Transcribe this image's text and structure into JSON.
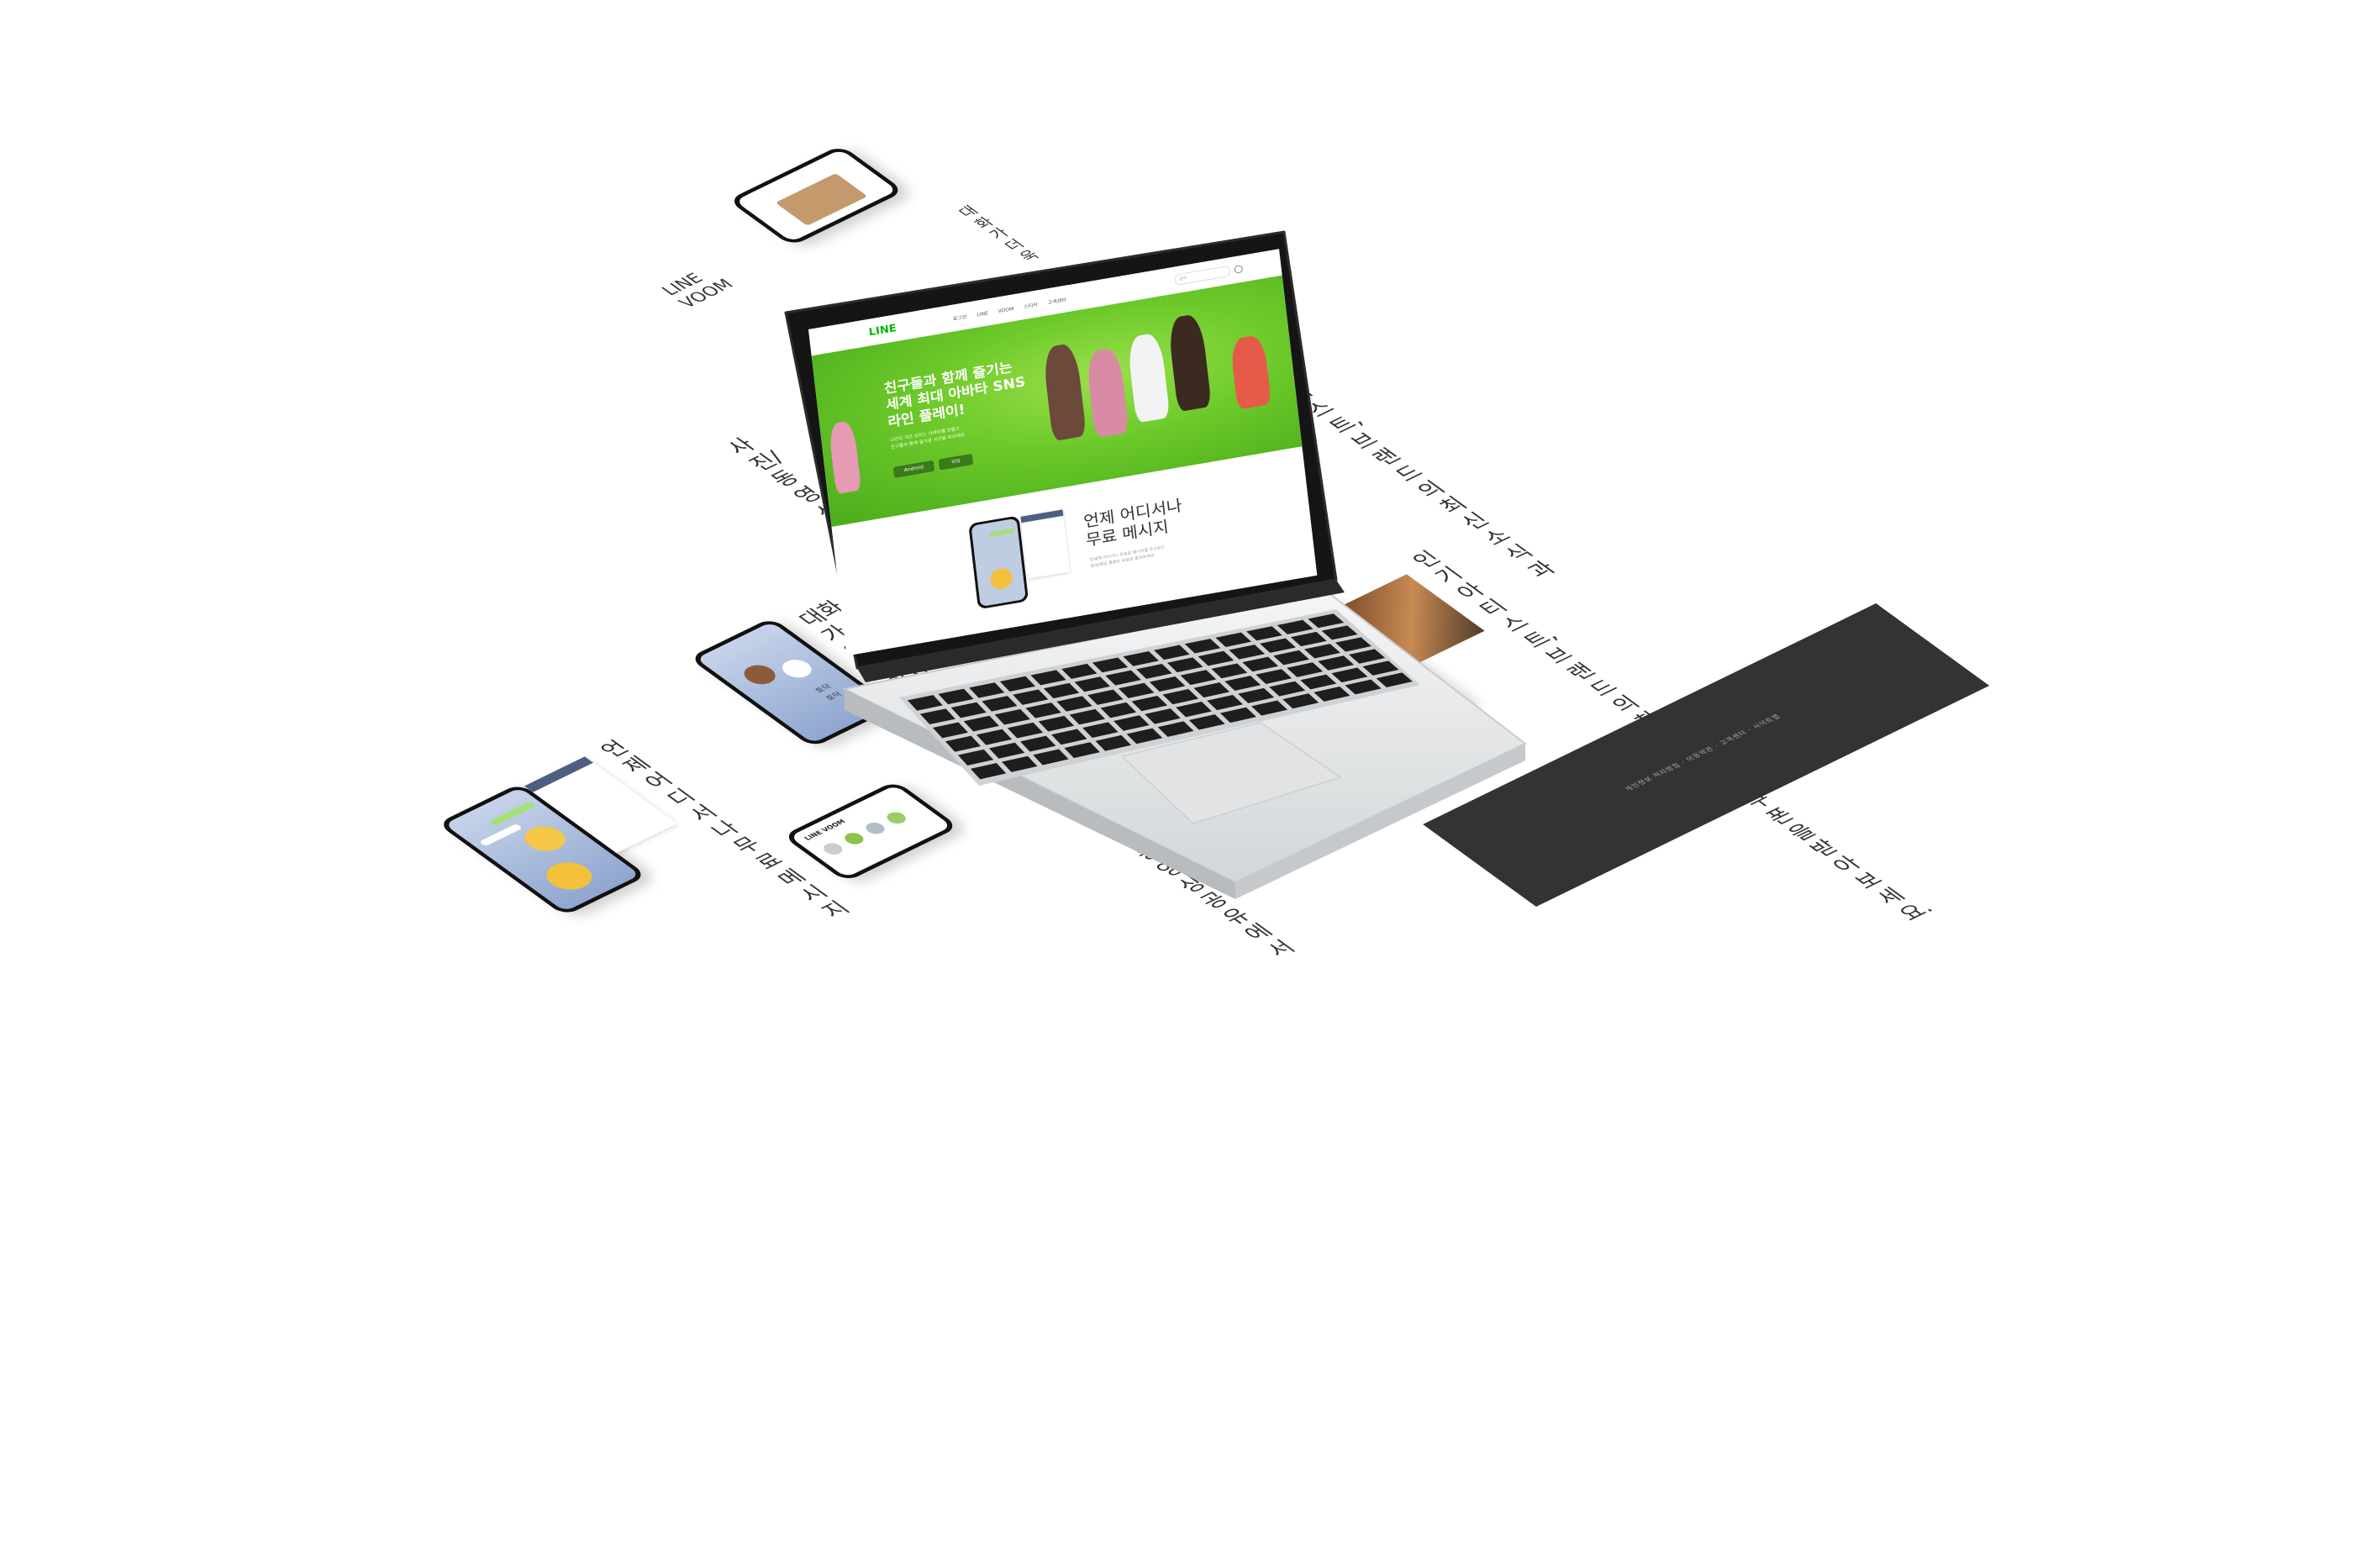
{
  "laptop": {
    "site": {
      "logo": "LINE",
      "menu": "로그인  LINE VOOM  스티커  고객센터",
      "search_placeholder": "검색",
      "hero_title": "친구들과 함께 즐기는\n세계 최대 아바타 SNS\n라인 플레이!",
      "hero_desc": "나만의 개성 넘치는 아바타를 만들고\n친구들과 함께 즐거운 시간을 보내세요.",
      "btn_android": "Android",
      "btn_ios": "iOS",
      "section_title": "언제 어디서나\n무료 메시지",
      "section_desc": "전세계 어디서나 무료로 메시지를 주고받고\n음성/영상 통화도 무료로 즐겨보세요."
    }
  },
  "floor": {
    "cards": [
      {
        "id": "message",
        "title": "언제 어디서나\n무료 메시지"
      },
      {
        "id": "voom-small",
        "label": "LINE VOOM"
      },
      {
        "id": "sticker",
        "title": "대화가 더욱\n즐거워지는\nLINE 스티커",
        "sticker_text_1": "토닥",
        "sticker_text_2": "토닥"
      },
      {
        "id": "photo",
        "title": "사진/동영상\n공유에서"
      },
      {
        "id": "brand-big",
        "title": "인기 아티스트,\n브랜드의\n최신소식과\n쿠폰을\n받아보세요."
      },
      {
        "id": "photo-right",
        "title": "사진/동영상\n공유에서\n음성 메시지까지"
      },
      {
        "id": "brand-right",
        "title": "인기 아티스트,\n브랜드의\n최신소식과"
      },
      {
        "id": "voom-right",
        "title": "LINE VOOM"
      },
      {
        "id": "sticker-right",
        "title": "대화가 더욱"
      }
    ],
    "footer": {
      "links": "개인정보 처리방침   ·   이용약관   ·   고객센터   ·   사이트맵"
    }
  },
  "colors": {
    "line_green": "#00b900",
    "hero_green": "#6cc92a",
    "lid": "#1a1a1a",
    "footer": "#333333"
  }
}
